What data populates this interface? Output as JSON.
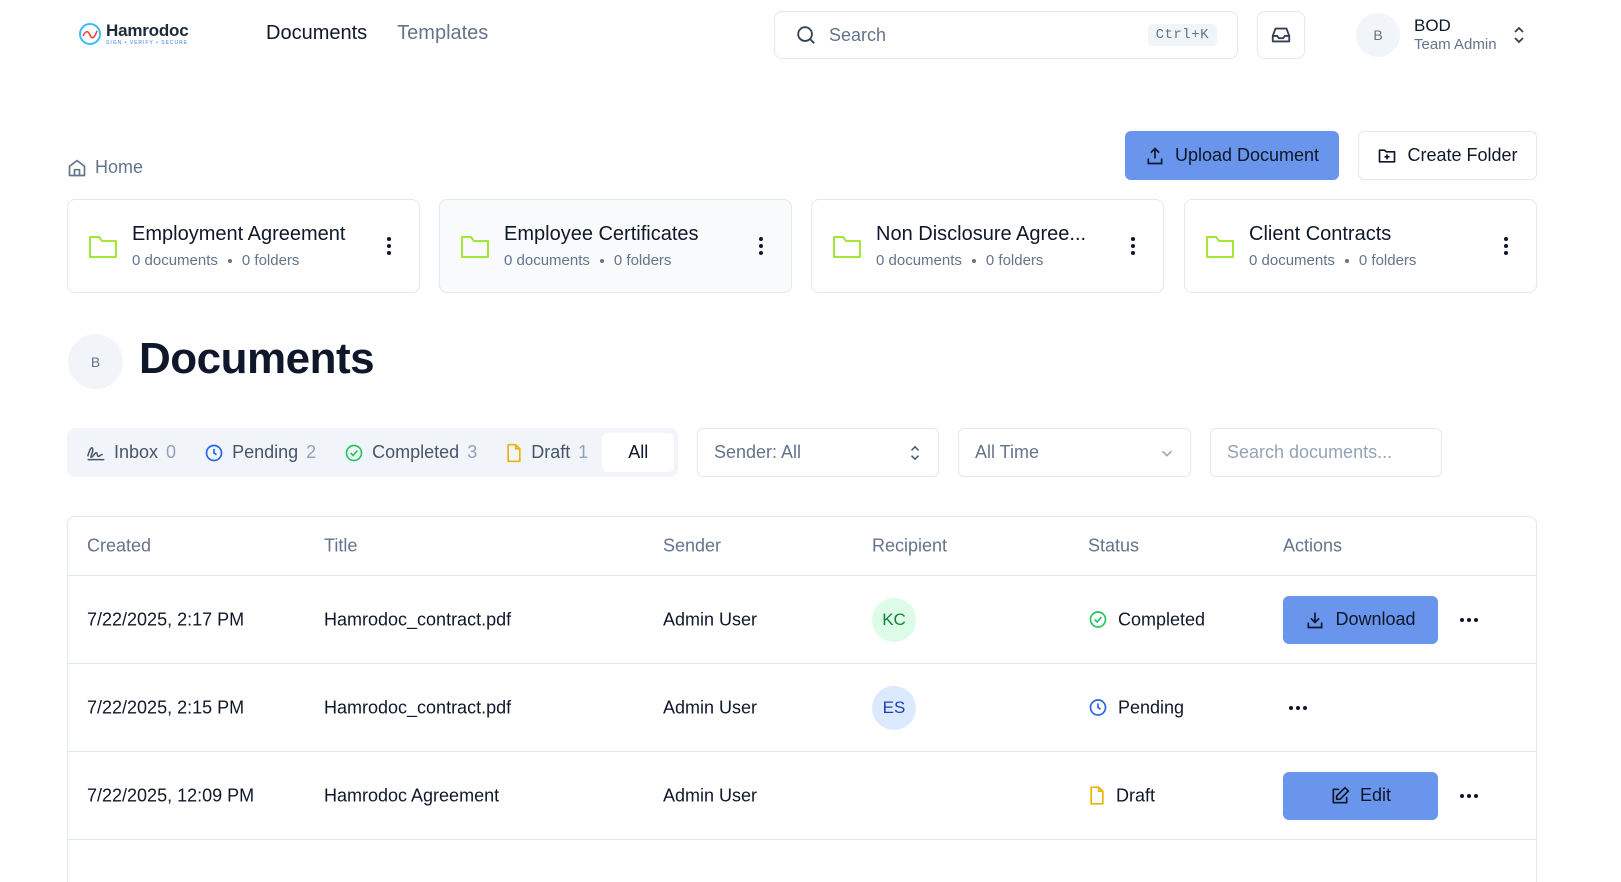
{
  "header": {
    "logo_name": "Hamrodoc",
    "logo_tagline": "SIGN • VERIFY • SECURE",
    "nav": [
      {
        "label": "Documents",
        "active": true
      },
      {
        "label": "Templates",
        "active": false
      }
    ],
    "search": {
      "placeholder": "Search",
      "shortcut": "Ctrl+K"
    },
    "user": {
      "initial": "B",
      "name": "BOD",
      "role": "Team Admin"
    }
  },
  "breadcrumb": {
    "label": "Home"
  },
  "actions": {
    "upload_label": "Upload Document",
    "create_folder_label": "Create Folder",
    "accent": "#6995ec"
  },
  "folders": [
    {
      "name": "Employment Agreement",
      "documents": "0 documents",
      "folders": "0 folders"
    },
    {
      "name": "Employee Certificates",
      "documents": "0 documents",
      "folders": "0 folders"
    },
    {
      "name": "Non Disclosure Agree...",
      "documents": "0 documents",
      "folders": "0 folders"
    },
    {
      "name": "Client Contracts",
      "documents": "0 documents",
      "folders": "0 folders"
    }
  ],
  "documents": {
    "avatar_initial": "B",
    "title": "Documents",
    "tabs": [
      {
        "label": "Inbox",
        "count": "0",
        "icon": "signature-icon"
      },
      {
        "label": "Pending",
        "count": "2",
        "icon": "clock-icon"
      },
      {
        "label": "Completed",
        "count": "3",
        "icon": "check-circle-icon"
      },
      {
        "label": "Draft",
        "count": "1",
        "icon": "file-icon"
      },
      {
        "label": "All",
        "count": "",
        "icon": ""
      }
    ],
    "filters": {
      "sender": "Sender: All",
      "time": "All Time",
      "search_placeholder": "Search documents..."
    },
    "columns": [
      "Created",
      "Title",
      "Sender",
      "Recipient",
      "Status",
      "Actions"
    ],
    "rows": [
      {
        "created": "7/22/2025, 2:17 PM",
        "title": "Hamrodoc_contract.pdf",
        "sender": "Admin User",
        "recipient": "KC",
        "status": "Completed",
        "action": "Download"
      },
      {
        "created": "7/22/2025, 2:15 PM",
        "title": "Hamrodoc_contract.pdf",
        "sender": "Admin User",
        "recipient": "ES",
        "status": "Pending",
        "action": ""
      },
      {
        "created": "7/22/2025, 12:09 PM",
        "title": "Hamrodoc Agreement",
        "sender": "Admin User",
        "recipient": "",
        "status": "Draft",
        "action": "Edit"
      }
    ]
  },
  "colors": {
    "folder": "#a3e635",
    "completed": "#22c55e",
    "pending": "#2563eb",
    "draft": "#eab308"
  }
}
